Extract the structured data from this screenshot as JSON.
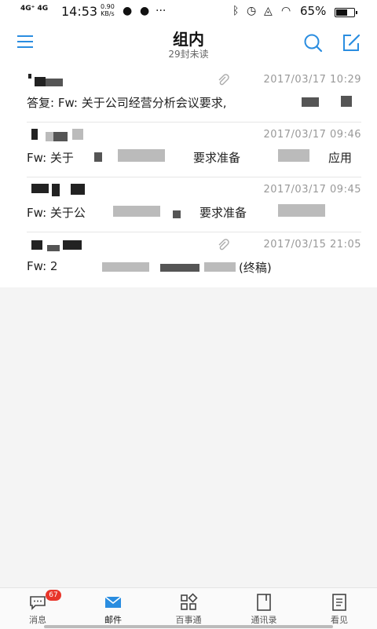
{
  "status_bar": {
    "network": "4G⁺ 4G",
    "time": "14:53",
    "speed_value": "0.90",
    "speed_unit": "KB/s",
    "battery": "65%"
  },
  "header": {
    "title": "组内",
    "subtitle": "29封未读"
  },
  "mails": [
    {
      "date": "2017/03/17  10:29",
      "subject": "答复: Fw: 关于公司经营分析会议要求,",
      "attachment": true
    },
    {
      "date": "2017/03/17  09:46",
      "subject": "Fw: 关于",
      "subject_tail": "要求准备",
      "subject_end": "应用",
      "attachment": false
    },
    {
      "date": "2017/03/17  09:45",
      "subject": "Fw: 关于公",
      "subject_tail": "要求准备",
      "attachment": false
    },
    {
      "date": "2017/03/15  21:05",
      "subject": "Fw: 2",
      "subject_end": "(终稿)",
      "attachment": true
    }
  ],
  "nav": {
    "messages": "消息",
    "messages_badge": "67",
    "mail": "邮件",
    "baishitong": "百事通",
    "contacts": "通讯录",
    "viewpoint": "看见"
  },
  "colors": {
    "accent": "#2a8de0",
    "badge": "#e8352a"
  }
}
